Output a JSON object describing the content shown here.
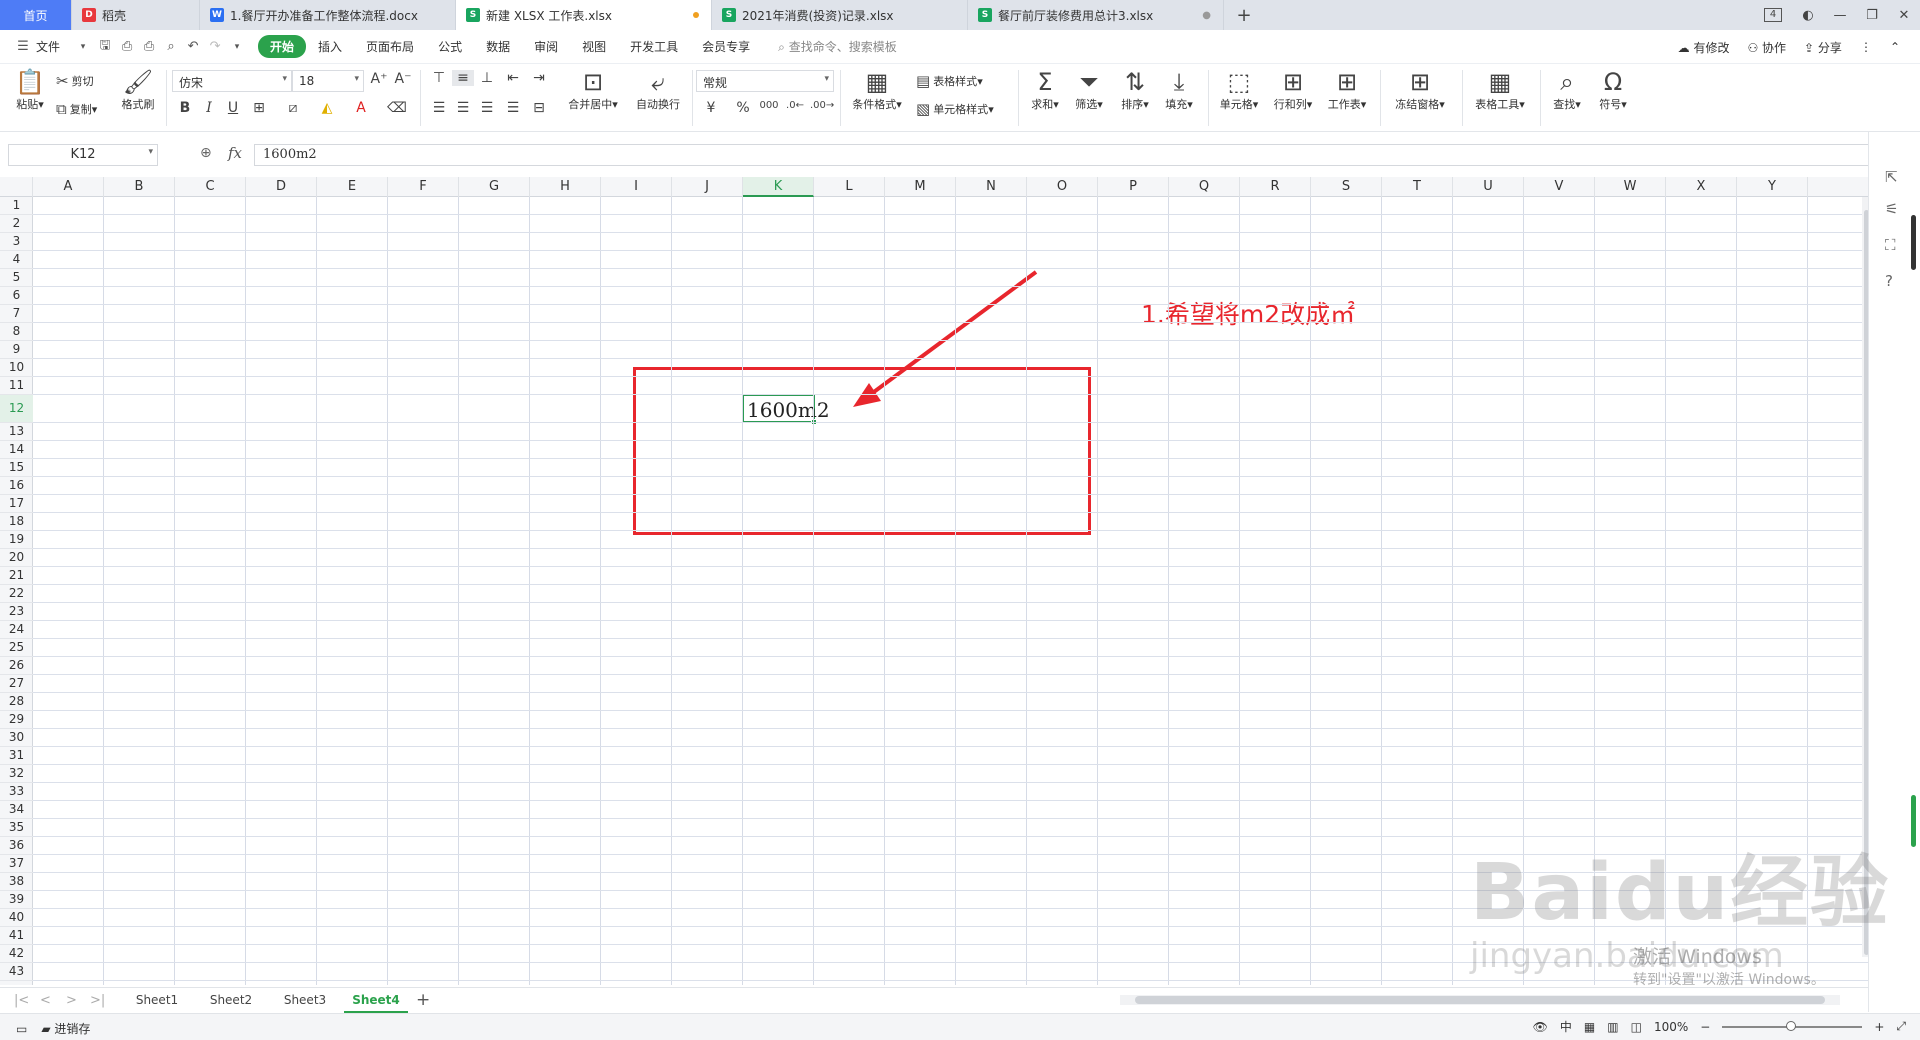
{
  "tabs": [
    {
      "label": "首页",
      "icon": "home"
    },
    {
      "label": "稻壳",
      "icon": "docer-icon",
      "color": "#e8383d"
    },
    {
      "label": "1.餐厅开办准备工作整体流程.docx",
      "icon": "word-icon",
      "color": "#2b6ff2"
    },
    {
      "label": "新建 XLSX 工作表.xlsx",
      "icon": "sheet-icon",
      "color": "#19a55f",
      "active": true
    },
    {
      "label": "2021年消费(投资)记录.xlsx",
      "icon": "sheet-icon",
      "color": "#19a55f"
    },
    {
      "label": "餐厅前厅装修费用总计3.xlsx",
      "icon": "sheet-icon",
      "color": "#19a55f"
    }
  ],
  "window_badge": "4",
  "menu": {
    "file": "文件",
    "items": [
      "开始",
      "插入",
      "页面布局",
      "公式",
      "数据",
      "审阅",
      "视图",
      "开发工具",
      "会员专享"
    ],
    "search_placeholder": "查找命令、搜索模板",
    "right": [
      "有修改",
      "协作",
      "分享"
    ]
  },
  "ribbon": {
    "paste": "粘贴",
    "cut": "剪切",
    "copy": "复制",
    "format_painter": "格式刷",
    "font_name": "仿宋",
    "font_size": "18",
    "merge_center": "合并居中",
    "wrap_text": "自动换行",
    "number_format": "常规",
    "cond_format": "条件格式",
    "table_style": "表格样式",
    "cell_style": "单元格样式",
    "sum": "求和",
    "filter": "筛选",
    "sort": "排序",
    "fill": "填充",
    "cell": "单元格",
    "row_col": "行和列",
    "worksheet": "工作表",
    "freeze": "冻结窗格",
    "table_tools": "表格工具",
    "find": "查找",
    "symbol": "符号"
  },
  "formula_bar": {
    "cell_ref": "K12",
    "fx": "fx",
    "content": "1600m2"
  },
  "sheet": {
    "columns": [
      "A",
      "B",
      "C",
      "D",
      "E",
      "F",
      "G",
      "H",
      "I",
      "J",
      "K",
      "L",
      "M",
      "N",
      "O",
      "P",
      "Q",
      "R",
      "S",
      "T",
      "U",
      "V",
      "W",
      "X",
      "Y"
    ],
    "selected_col": "K",
    "selected_row": "12",
    "rows": [
      "1",
      "2",
      "3",
      "4",
      "5",
      "6",
      "7",
      "8",
      "9",
      "10",
      "11",
      "12",
      "13",
      "14",
      "15",
      "16",
      "17",
      "18",
      "19",
      "20",
      "21",
      "22",
      "23",
      "24",
      "25",
      "26",
      "27",
      "28",
      "29",
      "30",
      "31",
      "32",
      "33",
      "34",
      "35",
      "36",
      "37",
      "38",
      "39",
      "40",
      "41",
      "42",
      "43"
    ],
    "cell_k12": "1600m2"
  },
  "annotation": "1.希望将m2改成㎡",
  "annotation_color": "#e8262d",
  "sheet_tabs": [
    "Sheet1",
    "Sheet2",
    "Sheet3",
    "Sheet4"
  ],
  "active_sheet": "Sheet4",
  "status": {
    "left_label": "进销存",
    "input_mode": "中",
    "zoom": "100%"
  },
  "watermark": {
    "brand": "Baidu经验",
    "url": "jingyan.baidu.com"
  },
  "activation": {
    "title": "激活 Windows",
    "subtitle": "转到\"设置\"以激活 Windows。"
  }
}
